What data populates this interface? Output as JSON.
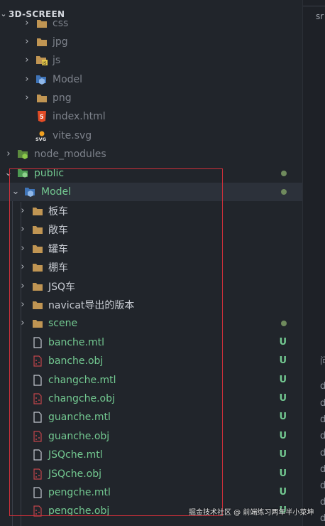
{
  "explorer": {
    "title": "3D-SCREEN",
    "rows": [
      {
        "label": "css",
        "status": "",
        "dot": ""
      },
      {
        "label": "jpg",
        "status": "",
        "dot": ""
      },
      {
        "label": "js",
        "status": "",
        "dot": ""
      },
      {
        "label": "Model",
        "status": "",
        "dot": ""
      },
      {
        "label": "png",
        "status": "",
        "dot": ""
      },
      {
        "label": "index.html",
        "status": "",
        "dot": ""
      },
      {
        "label": "vite.svg",
        "status": "",
        "dot": ""
      },
      {
        "label": "node_modules",
        "status": "",
        "dot": ""
      },
      {
        "label": "public",
        "status": "",
        "dot": "#6f8a5d"
      },
      {
        "label": "Model",
        "status": "",
        "dot": "#6f8a5d"
      },
      {
        "label": "板车",
        "status": "",
        "dot": ""
      },
      {
        "label": "敞车",
        "status": "",
        "dot": ""
      },
      {
        "label": "罐车",
        "status": "",
        "dot": ""
      },
      {
        "label": "棚车",
        "status": "",
        "dot": ""
      },
      {
        "label": "JSQ车",
        "status": "",
        "dot": ""
      },
      {
        "label": "navicat导出的版本",
        "status": "",
        "dot": ""
      },
      {
        "label": "scene",
        "status": "",
        "dot": "#6f8a5d"
      },
      {
        "label": "banche.mtl",
        "status": "U",
        "dot": ""
      },
      {
        "label": "banche.obj",
        "status": "U",
        "dot": ""
      },
      {
        "label": "changche.mtl",
        "status": "U",
        "dot": ""
      },
      {
        "label": "changche.obj",
        "status": "U",
        "dot": ""
      },
      {
        "label": "guanche.mtl",
        "status": "U",
        "dot": ""
      },
      {
        "label": "guanche.obj",
        "status": "U",
        "dot": ""
      },
      {
        "label": "JSQche.mtl",
        "status": "U",
        "dot": ""
      },
      {
        "label": "JSQche.obj",
        "status": "U",
        "dot": ""
      },
      {
        "label": "pengche.mtl",
        "status": "U",
        "dot": ""
      },
      {
        "label": "pengche.obj",
        "status": "U",
        "dot": ""
      }
    ]
  },
  "right_panel": {
    "tab_label": "sr",
    "chars": [
      "问",
      "d",
      "d",
      "d",
      "d",
      "d",
      "d",
      "d",
      "d",
      "d",
      "d"
    ]
  },
  "watermark": "掘金技术社区 @ 前端练习两年半小菜坤",
  "colors": {
    "untracked": "#73c991",
    "muted_text": "#8a8f99",
    "folder": "#c09553",
    "highlight_box": "#d0303a"
  }
}
